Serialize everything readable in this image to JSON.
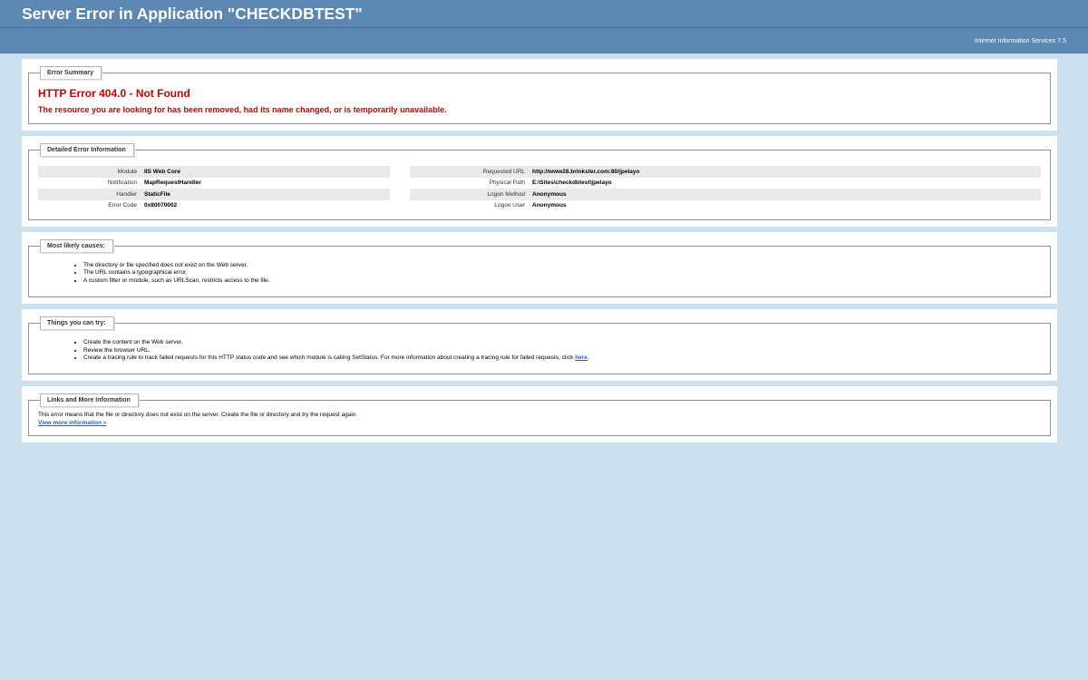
{
  "header": {
    "title": "Server Error in Application \"CHECKDBTEST\""
  },
  "subheader": {
    "server_info": "Internet Information Services 7.5"
  },
  "error_summary": {
    "legend": "Error Summary",
    "title": "HTTP Error 404.0 - Not Found",
    "description": "The resource you are looking for has been removed, had its name changed, or is temporarily unavailable."
  },
  "detailed_info": {
    "legend": "Detailed Error Information",
    "left": [
      {
        "label": "Module",
        "value": "IIS Web Core"
      },
      {
        "label": "Notification",
        "value": "MapRequestHandler"
      },
      {
        "label": "Handler",
        "value": "StaticFile"
      },
      {
        "label": "Error Code",
        "value": "0x80070002"
      }
    ],
    "right": [
      {
        "label": "Requested URL",
        "value": "http://www28.brinkster.com:80/jpelayo"
      },
      {
        "label": "Physical Path",
        "value": "E:\\Sites\\checkdbtest\\jpelayo"
      },
      {
        "label": "Logon Method",
        "value": "Anonymous"
      },
      {
        "label": "Logon User",
        "value": "Anonymous"
      }
    ]
  },
  "likely_causes": {
    "legend": "Most likely causes:",
    "items": [
      "The directory or file specified does not exist on the Web server.",
      "The URL contains a typographical error.",
      "A custom filter or module, such as URLScan, restricts access to the file."
    ]
  },
  "things_to_try": {
    "legend": "Things you can try:",
    "items": [
      "Create the content on the Web server.",
      "Review the browser URL.",
      "Create a tracing rule to track failed requests for this HTTP status code and see which module is calling SetStatus. For more information about creating a tracing rule for failed requests, click"
    ],
    "here_link": "here",
    "here_suffix": "."
  },
  "links": {
    "legend": "Links and More Information",
    "text": "This error means that the file or directory does not exist on the server. Create the file or directory and try the request again.",
    "more_link": "View more information »"
  }
}
